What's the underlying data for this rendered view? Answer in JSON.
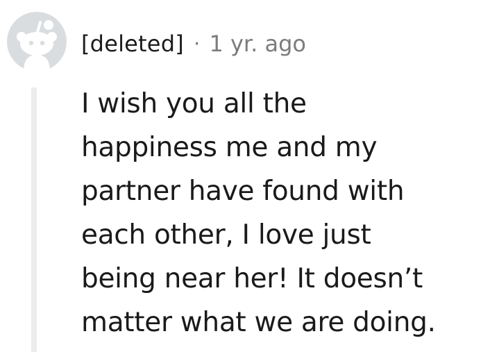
{
  "comment": {
    "author": "[deleted]",
    "separator": "·",
    "timestamp": "1 yr. ago",
    "avatar_icon": "snoo-avatar-icon",
    "body_lines": [
      "I wish you all the",
      "happiness me and my",
      "partner have found with",
      "each other, I love just",
      "being near her! It doesn’t",
      "matter what we are doing."
    ]
  },
  "colors": {
    "avatar_bg": "#dadde0",
    "thread_line": "#ececec",
    "meta_text": "#7c7c7c",
    "body_text": "#1a1a1a"
  }
}
